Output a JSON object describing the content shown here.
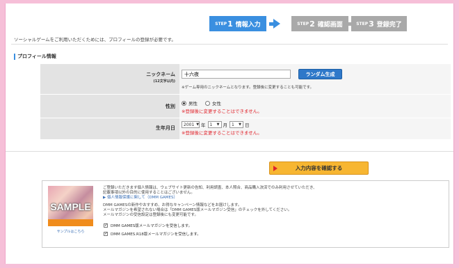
{
  "steps": [
    {
      "pre": "STEP",
      "num": "1",
      "label": "情報入力",
      "active": true
    },
    {
      "pre": "STEP",
      "num": "2",
      "label": "確認画面",
      "active": false
    },
    {
      "pre": "STEP",
      "num": "3",
      "label": "登録完了",
      "active": false
    }
  ],
  "notice": "ソーシャルゲームをご利用いただくためには、プロフィールの登録が必要です。",
  "section_title": "プロフィール情報",
  "form": {
    "nickname_label": "ニックネーム",
    "nickname_sub": "(12文字以内)",
    "nickname_value": "十六夜",
    "random_button": "ランダム生成",
    "nickname_hint": "※ゲーム専用のニックネームとなります。登録後に変更することも可能です。",
    "gender_label": "性別",
    "gender_male": "男性",
    "gender_female": "女性",
    "gender_selected": "male",
    "gender_note": "※登録後に変更することはできません。",
    "dob_label": "生年月日",
    "dob_year": "2001",
    "dob_year_unit": "年",
    "dob_month": "1",
    "dob_month_unit": "月",
    "dob_day": "1",
    "dob_day_unit": "日",
    "dob_note": "※登録後に変更することはできません。"
  },
  "confirm_button": "入力内容を確認する",
  "bottom": {
    "thumb_text": "SAMPLE",
    "thumb_caption": "サンプルはこちら",
    "text1": "ご登録いただきます個人情報は、ウェブサイト更新の告知、利用調査、本人照合、商品購入決済でのみ利用させていただき、",
    "text2": "記載事項以外の目的に使用することはございません。",
    "link": "▶ 個人情報保護に関して（DMM GAMES）",
    "text3": "DMM GAMESの新作やおすすめ、お得なキャンペーン情報などをお届けします。",
    "text4": "メールマガジンを希望されない場合は「DMM GAMES版メールマガジン受信」のチェックを外してください。",
    "text5": "メールマガジンの受信設定は登録後にも変更可能です。",
    "check1": "DMM GAMES版メールマガジンを受信します。",
    "check2": "DMM GAMES.R18版メールマガジンを受信します。"
  }
}
